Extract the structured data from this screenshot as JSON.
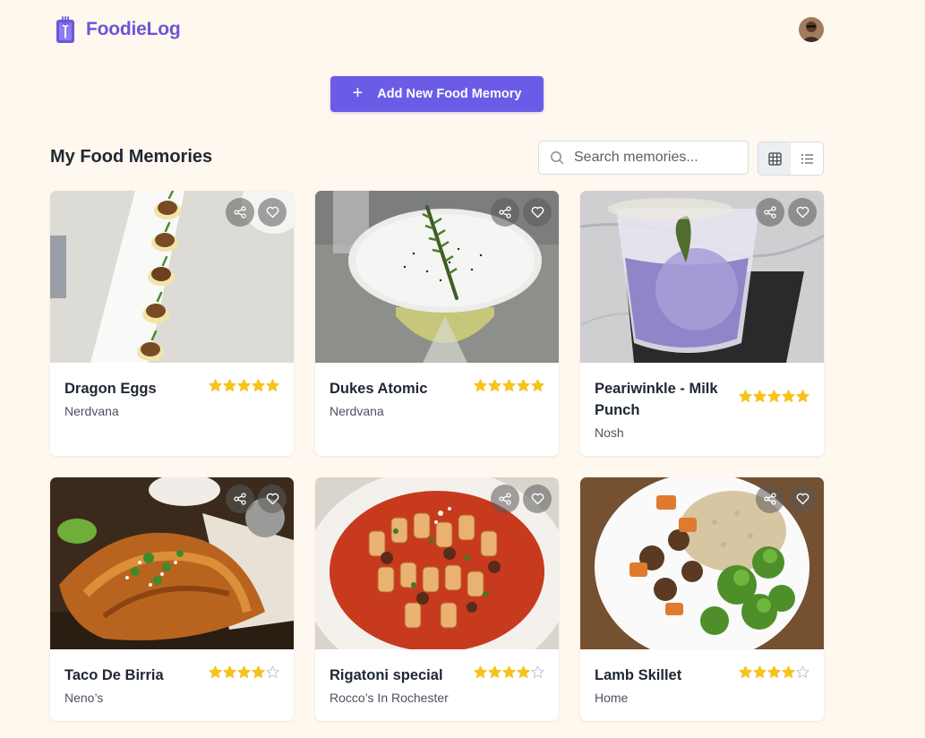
{
  "app": {
    "brand": "FoodieLog",
    "logo_icon": "journal-fork-icon"
  },
  "actions": {
    "add_label": "Add New Food Memory"
  },
  "section": {
    "title": "My Food Memories"
  },
  "search": {
    "placeholder": "Search memories..."
  },
  "view": {
    "active": "grid"
  },
  "colors": {
    "accent": "#6b5ce7",
    "brand": "#6b57d8",
    "star": "#f7c31b",
    "background": "#fff8ef"
  },
  "memories": [
    {
      "name": "Dragon Eggs",
      "place": "Nerdvana",
      "rating": 5,
      "photo": "deviled-eggs"
    },
    {
      "name": "Dukes Atomic",
      "place": "Nerdvana",
      "rating": 5,
      "photo": "cocktail-rosemary"
    },
    {
      "name": "Peariwinkle - Milk Punch",
      "place": "Nosh",
      "rating": 5,
      "photo": "purple-cocktail"
    },
    {
      "name": "Taco De Birria",
      "place": "Neno’s",
      "rating": 4,
      "photo": "birria-tacos"
    },
    {
      "name": "Rigatoni special",
      "place": "Rocco’s In Rochester",
      "rating": 4,
      "photo": "rigatoni"
    },
    {
      "name": "Lamb Skillet",
      "place": "Home",
      "rating": 4,
      "photo": "lamb-bowl"
    }
  ]
}
